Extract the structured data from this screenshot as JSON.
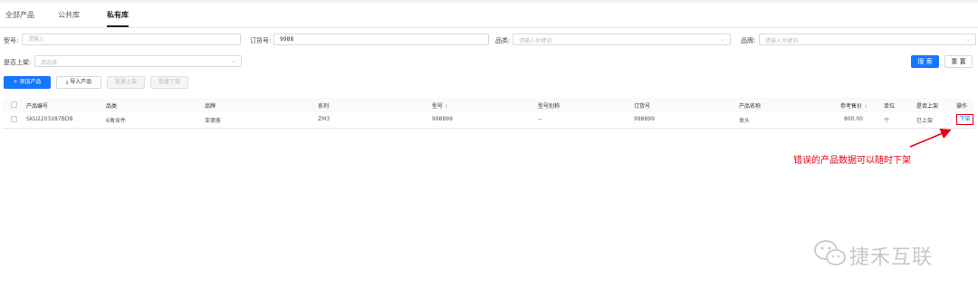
{
  "tabs": [
    {
      "label": "全部产品"
    },
    {
      "label": "公共库"
    },
    {
      "label": "私有库"
    }
  ],
  "filters": {
    "model": {
      "label": "型号:",
      "placeholder": "请输入"
    },
    "order": {
      "label": "订货号:",
      "value": "9988"
    },
    "category": {
      "label": "品类:",
      "placeholder": "请输入关键词"
    },
    "brand": {
      "label": "品牌:",
      "placeholder": "请输入关键词"
    },
    "listed": {
      "label": "是否上架:",
      "placeholder": "请选择"
    }
  },
  "buttons": {
    "search": "搜 索",
    "reset": "重 置",
    "add": "+ 添加产品",
    "import": "导入产品",
    "batch_up": "批量上架",
    "batch_down": "批量下架"
  },
  "table": {
    "columns": [
      "产品编号",
      "品类",
      "品牌",
      "系列",
      "型号",
      "型号别称",
      "订货号",
      "产品名称",
      "参考售价",
      "单位",
      "是否上架",
      "操作"
    ],
    "rows": [
      {
        "code": "SKU2203287BDB",
        "category": "6角含件",
        "brand": "亚德客",
        "series": "ZM3",
        "model": "998899",
        "alias": "--",
        "order_no": "998899",
        "name": "发头",
        "price": "800.00",
        "unit": "个",
        "listed": "已上架",
        "action": "下架"
      }
    ]
  },
  "annotation": {
    "text": "错误的产品数据可以随时下架",
    "color": "#e60012"
  },
  "watermark": "捷禾互联",
  "colors": {
    "accent": "#1677ff",
    "annotation": "#e60012"
  }
}
